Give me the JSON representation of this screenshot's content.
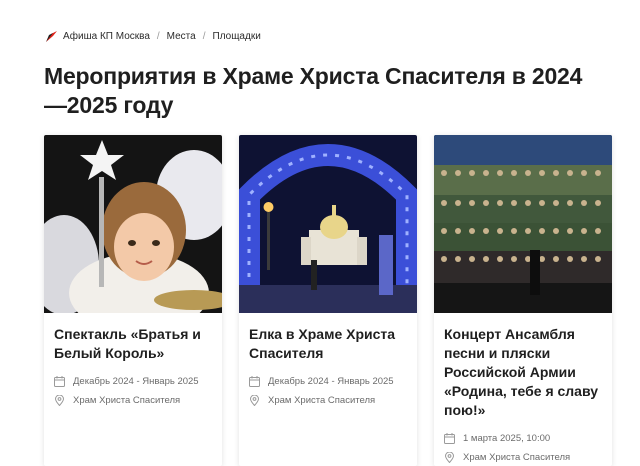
{
  "breadcrumb": {
    "items": [
      "Афиша КП Москва",
      "Места",
      "Площадки"
    ],
    "separator": "/"
  },
  "page": {
    "title": "Мероприятия в Храме Христа Спасителя в 2024—2025 году"
  },
  "cards": [
    {
      "title": "Спектакль «Братья и Белый Король»",
      "date": "Декабрь 2024 - Январь 2025",
      "venue": "Храм Христа Спасителя"
    },
    {
      "title": "Елка в Храме Христа Спасителя",
      "date": "Декабрь 2024 - Январь 2025",
      "venue": "Храм Христа Спасителя"
    },
    {
      "title": "Концерт Ансамбля песни и пляски Российской Армии «Родина, тебе я славу пою!»",
      "date": "1 марта 2025, 10:00",
      "venue": "Храм Христа Спасителя"
    }
  ],
  "icons": {
    "date": "calendar-icon",
    "venue": "location-pin-icon",
    "logo": "kp-logo-icon"
  },
  "colors": {
    "logo_red": "#e2231a",
    "text": "#1f1f1f",
    "meta": "#6b6b6b"
  }
}
